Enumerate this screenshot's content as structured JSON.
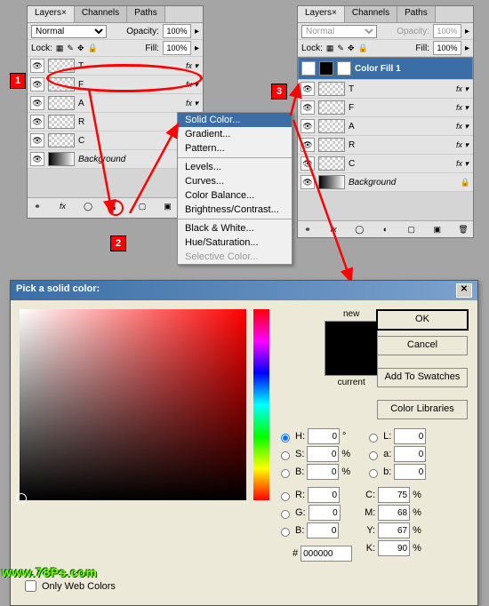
{
  "panel1": {
    "tabs": [
      "Layers",
      "Channels",
      "Paths"
    ],
    "blend_mode": "Normal",
    "opacity_label": "Opacity:",
    "opacity_value": "100%",
    "lock_label": "Lock:",
    "fill_label": "Fill:",
    "fill_value": "100%",
    "layers": [
      {
        "name": "T",
        "fx": true
      },
      {
        "name": "F",
        "fx": true
      },
      {
        "name": "A",
        "fx": true
      },
      {
        "name": "R",
        "fx": true
      },
      {
        "name": "C",
        "fx": true
      },
      {
        "name": "Background",
        "lock": true,
        "grad": true
      }
    ]
  },
  "panel2": {
    "tabs": [
      "Layers",
      "Channels",
      "Paths"
    ],
    "blend_mode": "Normal",
    "opacity_label": "Opacity:",
    "opacity_value": "100%",
    "lock_label": "Lock:",
    "fill_label": "Fill:",
    "fill_value": "100%",
    "sel_layer": "Color Fill 1",
    "layers": [
      {
        "name": "T",
        "fx": true
      },
      {
        "name": "F",
        "fx": true
      },
      {
        "name": "A",
        "fx": true
      },
      {
        "name": "R",
        "fx": true
      },
      {
        "name": "C",
        "fx": true
      },
      {
        "name": "Background",
        "lock": true,
        "grad": true
      }
    ]
  },
  "context_menu": {
    "items": [
      "Solid Color...",
      "Gradient...",
      "Pattern...",
      "-",
      "Levels...",
      "Curves...",
      "Color Balance...",
      "Brightness/Contrast...",
      "-",
      "Black & White...",
      "Hue/Saturation...",
      "Selective Color..."
    ]
  },
  "dialog": {
    "title": "Pick a solid color:",
    "new_label": "new",
    "current_label": "current",
    "buttons": {
      "ok": "OK",
      "cancel": "Cancel",
      "swatches": "Add To Swatches",
      "libraries": "Color Libraries"
    },
    "hsb": {
      "H": "0",
      "S": "0",
      "B": "0"
    },
    "lab": {
      "L": "0",
      "a": "0",
      "b": "0"
    },
    "rgb": {
      "R": "0",
      "G": "0",
      "B": "0"
    },
    "cmyk": {
      "C": "75",
      "M": "68",
      "Y": "67",
      "K": "90"
    },
    "hex": "000000",
    "web_colors": "Only Web Colors",
    "deg": "°",
    "pct": "%",
    "hash": "#"
  },
  "markers": {
    "1": "1",
    "2": "2",
    "3": "3"
  },
  "watermark": "www.78Ps.com"
}
